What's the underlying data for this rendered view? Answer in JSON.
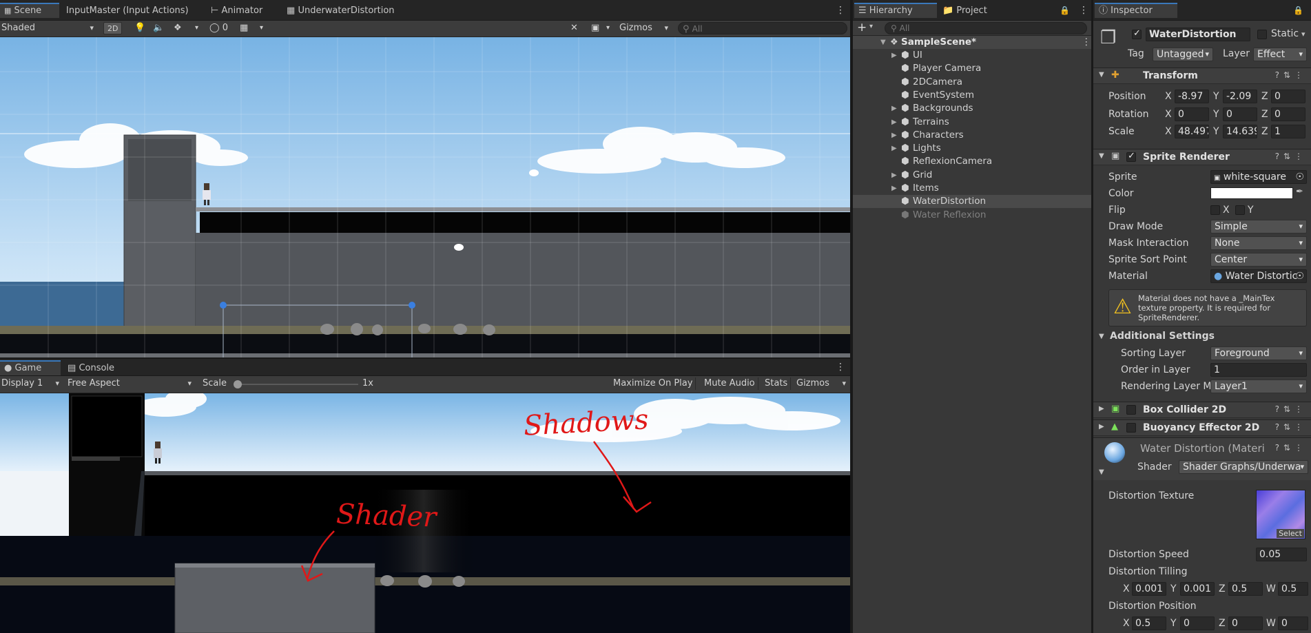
{
  "colors": {
    "accent": "#3a79bb",
    "sky_top": "#7fb7e6",
    "sky_bottom": "#ddeefa",
    "stone": "#575a5f",
    "water": "#2f4b68",
    "annotation": "#e01818"
  },
  "scene_panel": {
    "tabs": [
      {
        "label": "Scene",
        "icon": "scene-grid-icon"
      },
      {
        "label": "InputMaster (Input Actions)"
      },
      {
        "label": "Animator",
        "icon": "animator-icon"
      },
      {
        "label": "UnderwaterDistortion",
        "icon": "shader-icon"
      }
    ],
    "shading_mode": "Shaded",
    "mode_2d": "2D",
    "hidden_count": "0",
    "gizmos": "Gizmos",
    "search_placeholder": "All"
  },
  "game_panel": {
    "tabs": [
      {
        "label": "Game",
        "icon": "gamepad-icon"
      },
      {
        "label": "Console",
        "icon": "console-icon"
      }
    ],
    "display": "Display 1",
    "aspect": "Free Aspect",
    "scale_label": "Scale",
    "scale_value": "1x",
    "scale_fraction": 0.0,
    "buttons": [
      "Maximize On Play",
      "Mute Audio",
      "Stats",
      "Gizmos"
    ],
    "annotations": {
      "shadows": "Shadows",
      "shader": "Shader"
    }
  },
  "hierarchy": {
    "tabs": [
      {
        "label": "Hierarchy"
      },
      {
        "label": "Project"
      }
    ],
    "search_placeholder": "All",
    "scene_name": "SampleScene*",
    "items": [
      {
        "label": "UI",
        "expandable": true
      },
      {
        "label": "Player Camera",
        "expandable": false
      },
      {
        "label": "2DCamera",
        "expandable": false
      },
      {
        "label": "EventSystem",
        "expandable": false
      },
      {
        "label": "Backgrounds",
        "expandable": true
      },
      {
        "label": "Terrains",
        "expandable": true
      },
      {
        "label": "Characters",
        "expandable": true
      },
      {
        "label": "Lights",
        "expandable": true
      },
      {
        "label": "ReflexionCamera",
        "expandable": false
      },
      {
        "label": "Grid",
        "expandable": true
      },
      {
        "label": "Items",
        "expandable": true
      },
      {
        "label": "WaterDistortion",
        "expandable": false,
        "selected": true
      },
      {
        "label": "Water Reflexion",
        "expandable": false,
        "disabled": true
      }
    ]
  },
  "inspector": {
    "tab": "Inspector",
    "object_name": "WaterDistortion",
    "static_label": "Static",
    "tag_label": "Tag",
    "tag_value": "Untagged",
    "layer_label": "Layer",
    "layer_value": "Effect",
    "transform": {
      "title": "Transform",
      "position": {
        "label": "Position",
        "x": "-8.97",
        "y": "-2.09",
        "z": "0"
      },
      "rotation": {
        "label": "Rotation",
        "x": "0",
        "y": "0",
        "z": "0"
      },
      "scale": {
        "label": "Scale",
        "x": "48.497",
        "y": "14.639",
        "z": "1"
      }
    },
    "sprite_renderer": {
      "title": "Sprite Renderer",
      "sprite_label": "Sprite",
      "sprite_value": "white-square",
      "color_label": "Color",
      "color_value": "#ffffff",
      "flip_label": "Flip",
      "flip_x": "X",
      "flip_y": "Y",
      "draw_mode_label": "Draw Mode",
      "draw_mode_value": "Simple",
      "mask_label": "Mask Interaction",
      "mask_value": "None",
      "sort_point_label": "Sprite Sort Point",
      "sort_point_value": "Center",
      "material_label": "Material",
      "material_value": "Water Distortic",
      "warning": "Material does not have a _MainTex texture property. It is required for SpriteRenderer.",
      "additional_title": "Additional Settings",
      "sorting_layer_label": "Sorting Layer",
      "sorting_layer_value": "Foreground",
      "order_label": "Order in Layer",
      "order_value": "1",
      "rendering_layer_label": "Rendering Layer M",
      "rendering_layer_value": "Layer1"
    },
    "box_collider": {
      "title": "Box Collider 2D"
    },
    "buoyancy": {
      "title": "Buoyancy Effector 2D"
    },
    "material": {
      "title": "Water Distortion (Materi",
      "shader_label": "Shader",
      "shader_value": "Shader Graphs/Underwa",
      "texture_label": "Distortion Texture",
      "select_label": "Select",
      "speed_label": "Distortion Speed",
      "speed_value": "0.05",
      "tilling_label": "Distortion Tilling",
      "tilling": {
        "x": "0.001",
        "y": "0.001",
        "z": "0.5",
        "w": "0.5"
      },
      "position_label": "Distortion Position",
      "position": {
        "x": "0.5",
        "y": "0",
        "z": "0",
        "w": "0"
      }
    }
  }
}
